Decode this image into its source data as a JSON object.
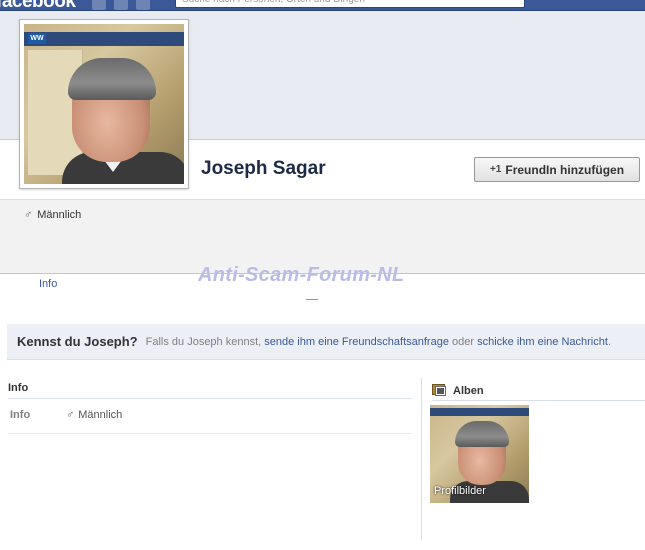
{
  "topbar": {
    "logo": "facebook",
    "search_placeholder": "Suche nach Personen, Orten und Dingen"
  },
  "profile": {
    "name": "Joseph Sagar",
    "add_friend_icon": "+1",
    "add_friend_label": "FreundIn hinzufügen",
    "gender": "Männlich",
    "info_tab": "Info"
  },
  "watermark": "Anti-Scam-Forum-NL",
  "prompt": {
    "title": "Kennst du Joseph?",
    "text_1": "Falls du Joseph kennst,",
    "link_1": "sende ihm eine Freundschaftsanfrage",
    "text_2": "oder",
    "link_2": "schicke ihm eine Nachricht",
    "text_3": "."
  },
  "info_section": {
    "header": "Info",
    "row_label": "Info",
    "row_value": "Männlich"
  },
  "albums": {
    "header": "Alben",
    "album_caption": "Profilbilder"
  },
  "colors": {
    "brand_blue": "#3b5998",
    "link_blue": "#3b5998",
    "watermark": "#b9bde6"
  },
  "icons": {
    "gender": "male-symbol-icon",
    "add_friend": "add-friend-icon",
    "albums": "photo-album-icon"
  }
}
